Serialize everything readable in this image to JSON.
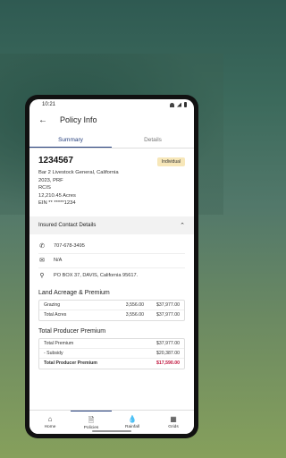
{
  "status_bar": {
    "time": "10:21"
  },
  "app_bar": {
    "title": "Policy Info"
  },
  "tabs": [
    {
      "label": "Summary",
      "active": true
    },
    {
      "label": "Details",
      "active": false
    }
  ],
  "summary": {
    "policy_number": "1234567",
    "badge": "Individual",
    "lines": [
      "Bar 2 Livestock General, California",
      "2023, PRF",
      "RCIS",
      "12,210.45 Acres",
      "EIN ** *****1234"
    ]
  },
  "insured_contact": {
    "title": "Insured Contact Details",
    "phone": "707-678-3495",
    "email": "N/A",
    "address": "PO BOX 37,  DAVIS, California 95617."
  },
  "land_acreage": {
    "title": "Land Acreage & Premium",
    "rows": [
      {
        "label": "Grazing",
        "acres": "3,556.00",
        "amount": "$37,977.00"
      },
      {
        "label": "Total Acres",
        "acres": "3,556.00",
        "amount": "$37,977.00"
      }
    ]
  },
  "producer_premium": {
    "title": "Total Producer Premium",
    "rows": [
      {
        "label": "Total Premium",
        "amount": "$37,977.00"
      },
      {
        "label": "- Subsidy",
        "amount": "$20,387.00"
      },
      {
        "label": "Total Producer Premium",
        "amount": "$17,590.00"
      }
    ]
  },
  "bottom_nav": [
    {
      "label": "Home",
      "icon": "home-icon"
    },
    {
      "label": "Policies",
      "icon": "document-icon"
    },
    {
      "label": "Rainfall",
      "icon": "raindrop-icon"
    },
    {
      "label": "Grids",
      "icon": "grid-icon"
    }
  ],
  "colors": {
    "accent": "#243e7c",
    "badge_bg": "#f7e7b9",
    "negative": "#c0143c"
  }
}
